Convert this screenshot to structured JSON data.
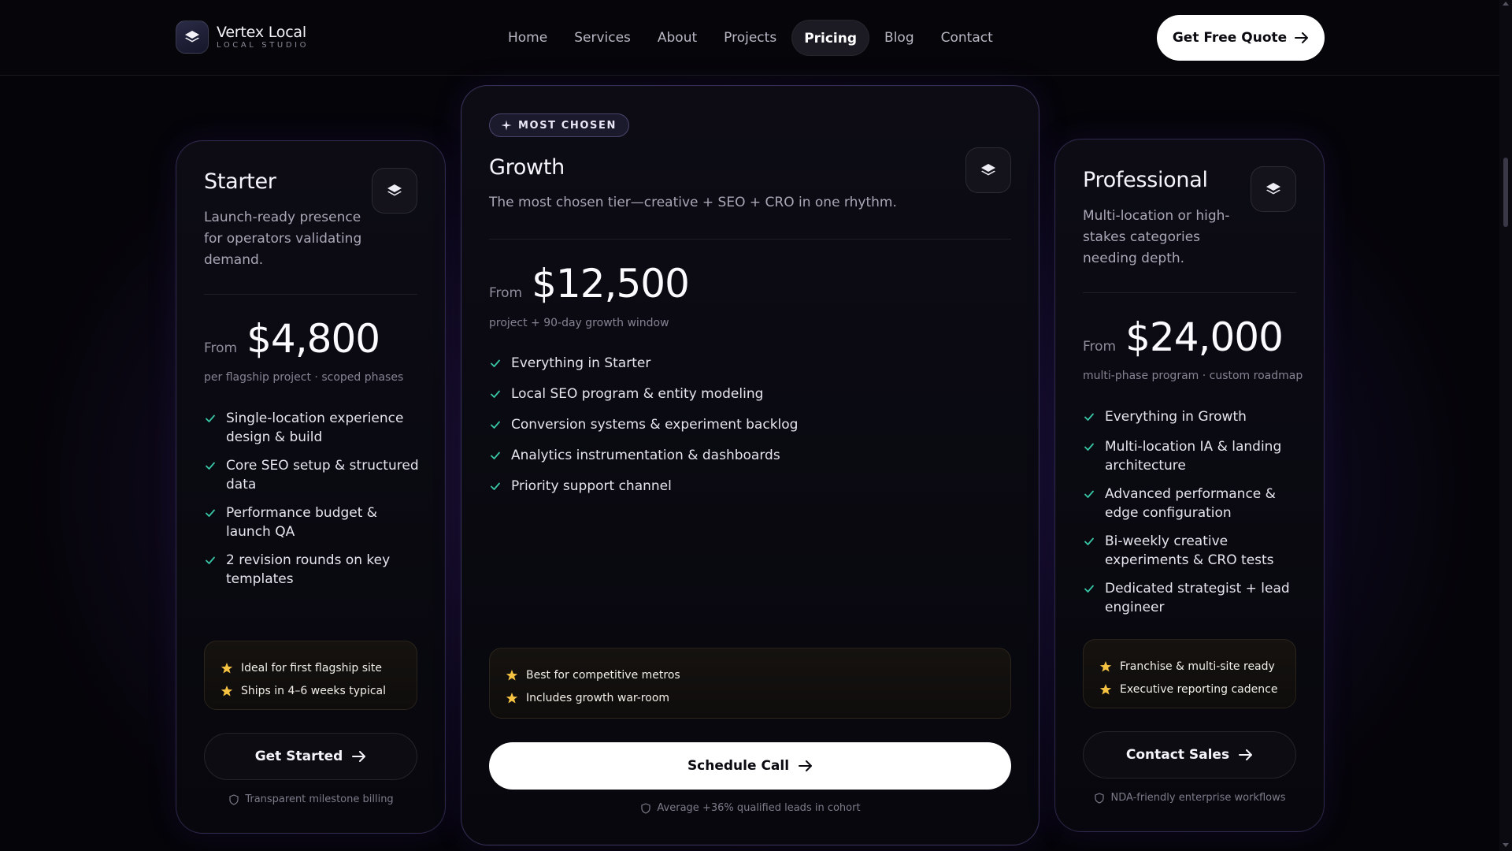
{
  "brand": {
    "name": "Vertex Local",
    "subtitle": "LOCAL STUDIO",
    "logo_icon": "layers-icon"
  },
  "nav": [
    {
      "label": "Home",
      "active": false
    },
    {
      "label": "Services",
      "active": false
    },
    {
      "label": "About",
      "active": false
    },
    {
      "label": "Projects",
      "active": false
    },
    {
      "label": "Pricing",
      "active": true
    },
    {
      "label": "Blog",
      "active": false
    },
    {
      "label": "Contact",
      "active": false
    }
  ],
  "header_cta": {
    "label": "Get Free Quote",
    "icon": "arrow-right-icon"
  },
  "colors": {
    "accent_check": "#38c7a6",
    "star": "#f5c242",
    "border": "#8c78e6"
  },
  "plans": {
    "starter": {
      "title": "Starter",
      "description": "Launch-ready presence for operators validating demand.",
      "price_prefix": "From",
      "price": "$4,800",
      "price_note": "per flagship project · scoped phases",
      "features": [
        "Single-location experience design & build",
        "Core SEO setup & structured data",
        "Performance budget & launch QA",
        "2 revision rounds on key templates"
      ],
      "highlights": [
        "Ideal for first flagship site",
        "Ships in 4–6 weeks typical"
      ],
      "cta": "Get Started",
      "footnote": "Transparent milestone billing"
    },
    "growth": {
      "badge": "MOST CHOSEN",
      "title": "Growth",
      "description": "The most chosen tier—creative + SEO + CRO in one rhythm.",
      "price_prefix": "From",
      "price": "$12,500",
      "price_note": "project + 90-day growth window",
      "features": [
        "Everything in Starter",
        "Local SEO program & entity modeling",
        "Conversion systems & experiment backlog",
        "Analytics instrumentation & dashboards",
        "Priority support channel"
      ],
      "highlights": [
        "Best for competitive metros",
        "Includes growth war-room"
      ],
      "cta": "Schedule Call",
      "footnote": "Average +36% qualified leads in cohort"
    },
    "professional": {
      "title": "Professional",
      "description": "Multi-location or high-stakes categories needing depth.",
      "price_prefix": "From",
      "price": "$24,000",
      "price_note": "multi-phase program · custom roadmap",
      "features": [
        "Everything in Growth",
        "Multi-location IA & landing architecture",
        "Advanced performance & edge configuration",
        "Bi-weekly creative experiments & CRO tests",
        "Dedicated strategist + lead engineer"
      ],
      "highlights": [
        "Franchise & multi-site ready",
        "Executive reporting cadence"
      ],
      "cta": "Contact Sales",
      "footnote": "NDA-friendly enterprise workflows"
    }
  }
}
